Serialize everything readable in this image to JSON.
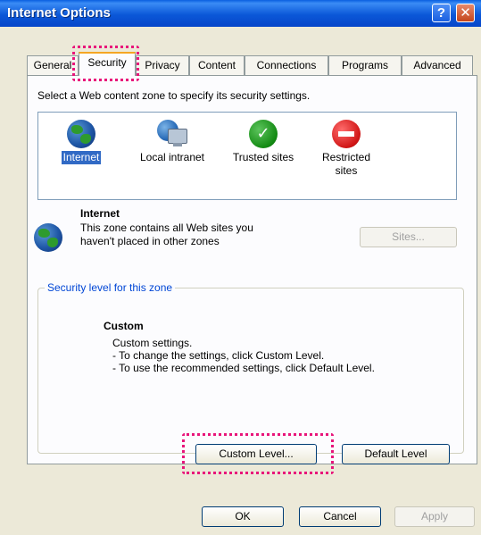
{
  "window": {
    "title": "Internet Options",
    "help_glyph": "?",
    "close_glyph": "✕"
  },
  "tabs": [
    "General",
    "Security",
    "Privacy",
    "Content",
    "Connections",
    "Programs",
    "Advanced"
  ],
  "security": {
    "prompt": "Select a Web content zone to specify its security settings.",
    "zones": {
      "internet": "Internet",
      "local_intranet": "Local intranet",
      "trusted_sites": "Trusted sites",
      "restricted_line1": "Restricted",
      "restricted_line2": "sites"
    },
    "selected_zone": {
      "title": "Internet",
      "desc_line1": "This zone contains all Web sites you",
      "desc_line2": "haven't placed in other zones"
    },
    "sites_button": "Sites...",
    "group_legend": "Security level for this zone",
    "level_title": "Custom",
    "level_lines": [
      "Custom settings.",
      "- To change the settings, click Custom Level.",
      "- To use the recommended settings, click Default Level."
    ],
    "custom_level_button": "Custom Level...",
    "default_level_button": "Default Level"
  },
  "footer": {
    "ok": "OK",
    "cancel": "Cancel",
    "apply": "Apply"
  },
  "colors": {
    "title_bar": "#0a5fe0",
    "highlight": "#e8157a",
    "selection": "#316ac5",
    "legend": "#0046d5"
  }
}
